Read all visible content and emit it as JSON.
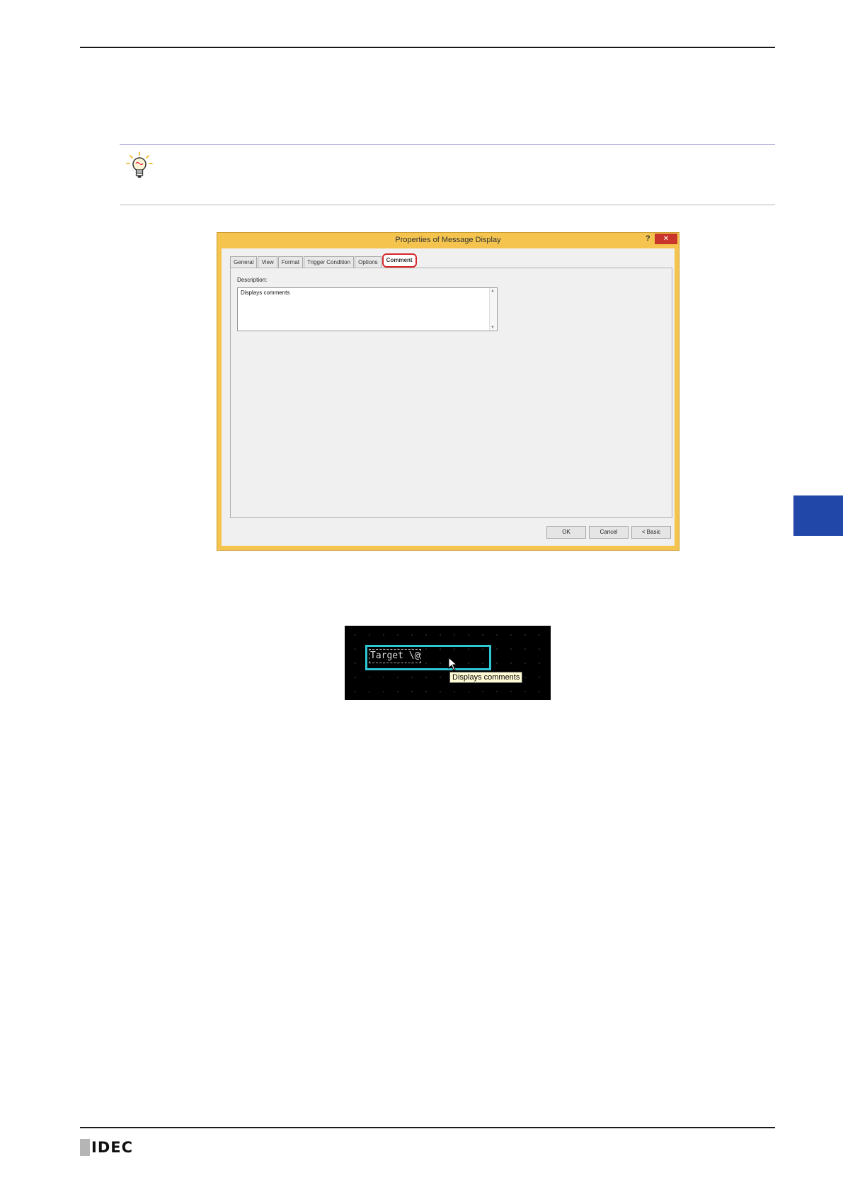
{
  "dialog": {
    "title": "Properties of Message Display",
    "help_symbol": "?",
    "close_symbol": "✕",
    "tabs": [
      "General",
      "View",
      "Format",
      "Trigger Condition",
      "Options",
      "Comment"
    ],
    "active_tab": "Comment",
    "description_label": "Description:",
    "description_value": "Displays comments",
    "buttons": {
      "ok": "OK",
      "cancel": "Cancel",
      "basic": "< Basic"
    }
  },
  "preview": {
    "message_text": "Target  \\@",
    "tooltip": "Displays comments"
  },
  "footer": {
    "logo": "IDEC"
  },
  "colors": {
    "side_tab": "#2148a8",
    "dialog_frame": "#f4c44f",
    "highlight": "#d6262a",
    "selection": "#2fc7d6"
  },
  "icons": [
    "lightbulb-icon",
    "mouse-pointer-icon"
  ]
}
